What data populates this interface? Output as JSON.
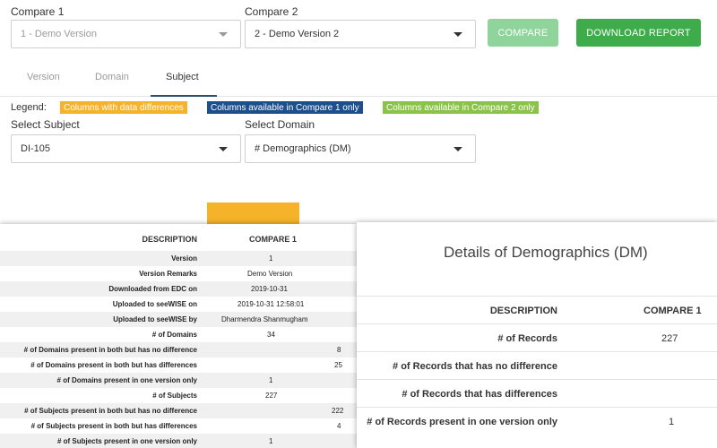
{
  "compare1": {
    "label": "Compare 1",
    "value": "1 - Demo Version"
  },
  "compare2": {
    "label": "Compare 2",
    "value": "2 - Demo Version 2"
  },
  "buttons": {
    "compare": "COMPARE",
    "download": "DOWNLOAD REPORT"
  },
  "tabs": [
    {
      "label": "Version"
    },
    {
      "label": "Domain"
    },
    {
      "label": "Subject"
    }
  ],
  "legend": {
    "label": "Legend:",
    "items": [
      {
        "text": "Columns with data differences",
        "color": "#f5b32a"
      },
      {
        "text": "Columns available in Compare 1 only",
        "color": "#1d4f8c"
      },
      {
        "text": "Columns available in Compare 2 only",
        "color": "#8bc34a"
      }
    ]
  },
  "subject": {
    "label": "Select Subject",
    "value": "DI-105"
  },
  "domain": {
    "label": "Select Domain",
    "value": "# Demographics (DM)"
  },
  "left_table": {
    "headers": {
      "description": "DESCRIPTION",
      "compare": "COMPARE 1"
    },
    "rows": [
      {
        "d": "Version",
        "v": "1"
      },
      {
        "d": "Version Remarks",
        "v": "Demo Version"
      },
      {
        "d": "Downloaded from EDC on",
        "v": "2019-10-31"
      },
      {
        "d": "Uploaded to seeWISE on",
        "v": "2019-10-31 12:58:01"
      },
      {
        "d": "Uploaded to seeWISE by",
        "v": "Dharmendra Shanmugham"
      },
      {
        "d": "# of Domains",
        "v": "34"
      },
      {
        "d": "# of Domains present in both but has no difference",
        "v": "8"
      },
      {
        "d": "# of Domains present in both but has differences",
        "v": "25"
      },
      {
        "d": "# of Domains present in one version only",
        "v": "1"
      },
      {
        "d": "# of Subjects",
        "v": "227"
      },
      {
        "d": "# of Subjects present in both but has no difference",
        "v": "222"
      },
      {
        "d": "# of Subjects present in both but has differences",
        "v": "4"
      },
      {
        "d": "# of Subjects present in one version only",
        "v": "1"
      }
    ]
  },
  "right_panel": {
    "title": "Details of Demographics (DM)",
    "headers": {
      "description": "DESCRIPTION",
      "compare": "COMPARE 1"
    },
    "rows": [
      {
        "d": "# of Records",
        "v": "227"
      },
      {
        "d": "# of Records that has no difference",
        "v": ""
      },
      {
        "d": "# of Records that has differences",
        "v": ""
      },
      {
        "d": "# of Records present in one version only",
        "v": "1"
      }
    ]
  }
}
